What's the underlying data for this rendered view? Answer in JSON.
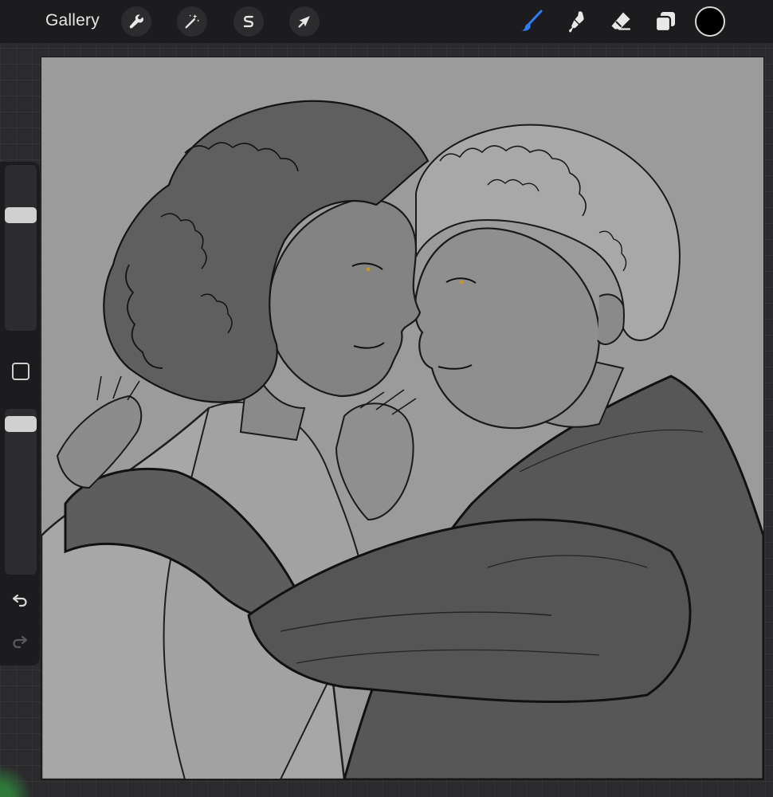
{
  "toolbar": {
    "gallery_label": "Gallery",
    "left_tools": [
      {
        "name": "actions",
        "icon": "wrench-icon"
      },
      {
        "name": "adjustments",
        "icon": "magic-wand-icon"
      },
      {
        "name": "selection",
        "icon": "selection-s-icon"
      },
      {
        "name": "transform",
        "icon": "arrow-cursor-icon"
      }
    ],
    "right_tools": [
      {
        "name": "brush",
        "icon": "brush-icon",
        "active": true
      },
      {
        "name": "smudge",
        "icon": "smudge-icon"
      },
      {
        "name": "eraser",
        "icon": "eraser-icon"
      },
      {
        "name": "layers",
        "icon": "layers-icon"
      }
    ],
    "active_color": "#000000",
    "active_tool_color": "#2f7cf6"
  },
  "sidebar": {
    "brush_size_level": 0.72,
    "opacity_level": 0.95,
    "icons": [
      "modify-square-icon",
      "undo-icon",
      "redo-icon"
    ]
  },
  "canvas": {
    "background_color": "#9b9b9b",
    "content": "artwork-illustration"
  }
}
